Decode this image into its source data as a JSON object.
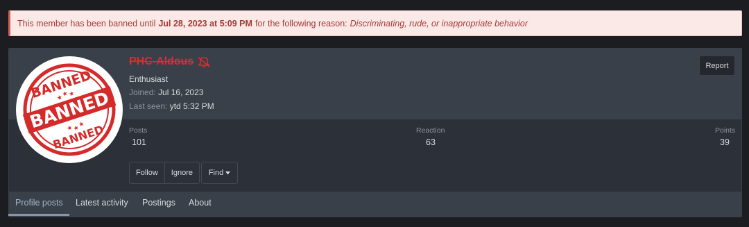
{
  "ban_notice": {
    "prefix": "This member has been banned until",
    "until": "Jul 28, 2023 at 5:09 PM",
    "middle": "for the following reason:",
    "reason": "Discriminating, rude, or inappropriate behavior"
  },
  "profile": {
    "username": "PHC-Aldous",
    "user_title": "Enthusiast",
    "joined_label": "Joined:",
    "joined_value": "Jul 16, 2023",
    "last_seen_label": "Last seen:",
    "last_seen_value": "ytd 5:32 PM",
    "avatar_text_top": "BANNED",
    "avatar_text_mid": "BANNED",
    "avatar_text_bottom": "BANNED"
  },
  "actions": {
    "report": "Report",
    "follow": "Follow",
    "ignore": "Ignore",
    "find": "Find"
  },
  "stats": {
    "posts_label": "Posts",
    "posts_value": "101",
    "reaction_label": "Reaction",
    "reaction_value": "63",
    "points_label": "Points",
    "points_value": "39"
  },
  "tabs": [
    {
      "label": "Profile posts"
    },
    {
      "label": "Latest activity"
    },
    {
      "label": "Postings"
    },
    {
      "label": "About"
    }
  ],
  "colors": {
    "accent": "#8497ab",
    "banned_red": "#e3282f",
    "notice_bg": "#fbe9e8",
    "notice_text": "#a53a33"
  },
  "icons": {
    "username_badge": "no-bell-icon",
    "find_caret": "caret-down-icon"
  }
}
